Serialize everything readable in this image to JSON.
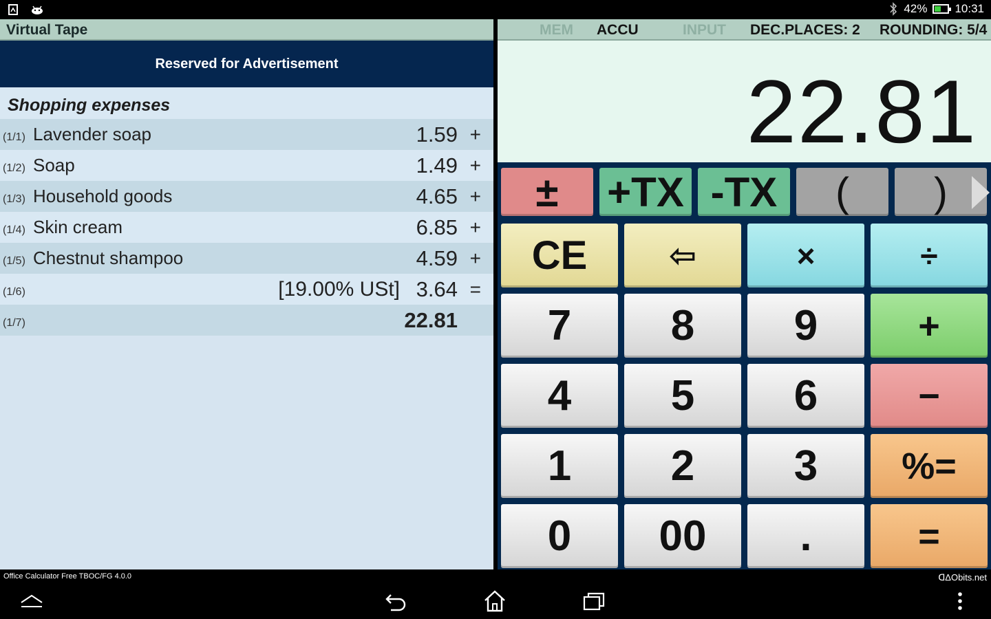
{
  "status_bar": {
    "battery": "42%",
    "battery_level": 0.42,
    "time": "10:31",
    "icons": [
      "sim-icon",
      "android-icon",
      "bluetooth-icon"
    ]
  },
  "tape": {
    "header": "Virtual Tape",
    "ad_text": "Reserved for Advertisement",
    "title": "Shopping expenses",
    "rows": [
      {
        "index": "(1/1)",
        "label": "Lavender soap",
        "tax": "",
        "value": "1.59",
        "op": "+"
      },
      {
        "index": "(1/2)",
        "label": "Soap",
        "tax": "",
        "value": "1.49",
        "op": "+"
      },
      {
        "index": "(1/3)",
        "label": "Household goods",
        "tax": "",
        "value": "4.65",
        "op": "+"
      },
      {
        "index": "(1/4)",
        "label": "Skin cream",
        "tax": "",
        "value": "6.85",
        "op": "+"
      },
      {
        "index": "(1/5)",
        "label": "Chestnut shampoo",
        "tax": "",
        "value": "4.59",
        "op": "+"
      },
      {
        "index": "(1/6)",
        "label": "",
        "tax": "[19.00% USt]",
        "value": "3.64",
        "op": "="
      },
      {
        "index": "(1/7)",
        "label": "",
        "tax": "",
        "value": "22.81",
        "op": ""
      }
    ]
  },
  "calc": {
    "status": {
      "mem": "MEM",
      "accu": "ACCU",
      "input": "INPUT",
      "dec_places": "DEC.PLACES: 2",
      "rounding": "ROUNDING: 5/4"
    },
    "display": "22.81",
    "function_keys": {
      "plus_minus": "±",
      "plus_tx": "+TX",
      "minus_tx": "-TX",
      "open_paren": "(",
      "close_paren": ")"
    },
    "keys": {
      "ce": "CE",
      "backspace": "⇦",
      "multiply": "×",
      "divide": "÷",
      "seven": "7",
      "eight": "8",
      "nine": "9",
      "plus": "+",
      "four": "4",
      "five": "5",
      "six": "6",
      "minus": "−",
      "one": "1",
      "two": "2",
      "three": "3",
      "percent_equals": "%=",
      "zero": "0",
      "double_zero": "00",
      "decimal": ".",
      "equals": "="
    }
  },
  "footer": {
    "app_info": "Office Calculator Free  TBOC/FG 4.0.0",
    "vendor": "ᗡΔObits.net"
  },
  "colors": {
    "panel_navy": "#04284e",
    "header_green": "#b3cfc3",
    "display_bg": "#e6f7ef",
    "tape_row_dark": "#c4d9e4",
    "tape_row_light": "#d9e8f3"
  }
}
